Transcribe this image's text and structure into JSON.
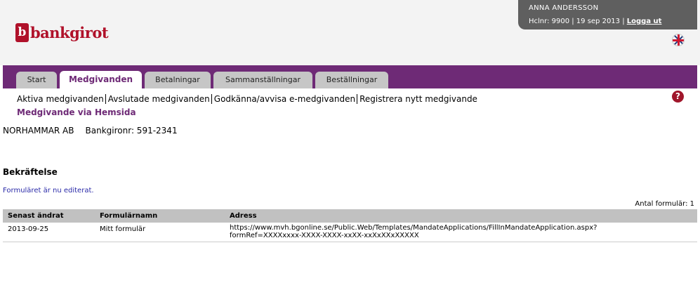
{
  "brand": {
    "mark": "b",
    "name": "bankgirot"
  },
  "user": {
    "name": "ANNA ANDERSSON",
    "info": "Hclnr: 9900 | 19 sep 2013 | ",
    "logout": "Logga ut"
  },
  "tabs": [
    "Start",
    "Medgivanden",
    "Betalningar",
    "Sammanställningar",
    "Beställningar"
  ],
  "active_tab": "Medgivanden",
  "subnav": {
    "items": [
      "Aktiva medgivanden",
      "Avslutade medgivanden",
      "Godkänna/avvisa e-medgivanden",
      "Registrera nytt medgivande"
    ],
    "active": "Medgivande via Hemsida"
  },
  "help": "?",
  "company": {
    "name": "NORHAMMAR AB",
    "bankgiro": "Bankgironr: 591-2341"
  },
  "page_title": "Bekräftelse",
  "notice": "Formuläret är nu editerat.",
  "count": "Antal formulär:  1",
  "table": {
    "headers": [
      "Senast ändrat",
      "Formulärnamn",
      "Adress"
    ],
    "rows": [
      {
        "date": "2013-09-25",
        "name": "Mitt formulär",
        "address_line1": "https://www.mvh.bgonline.se/Public.Web/Templates/MandateApplications/FillInMandateApplication.aspx?",
        "address_line2": "formRef=XXXXxxxx-XXXX-XXXX-xxXX-xxXxXXxXXXXX"
      }
    ]
  },
  "colors": {
    "brand_red": "#b0112a",
    "nav_purple": "#6e2a76",
    "header_bg": "#f3f3f3",
    "table_header": "#c1c1c1"
  }
}
